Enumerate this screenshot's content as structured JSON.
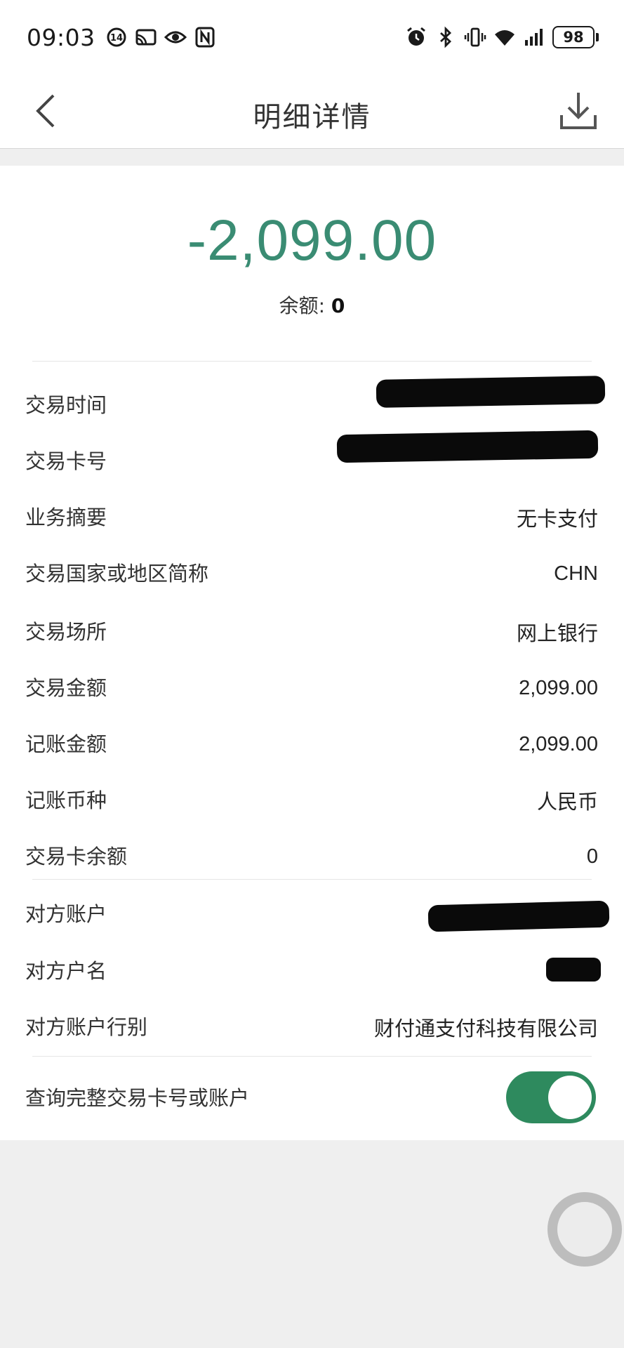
{
  "status_bar": {
    "time": "09:03",
    "battery": "98",
    "left_icons": [
      "sync-icon",
      "cast-icon",
      "eye-icon",
      "nfc-icon"
    ],
    "right_icons": [
      "alarm-icon",
      "bluetooth-icon",
      "vibrate-icon",
      "wifi-icon",
      "signal-icon",
      "battery-icon"
    ]
  },
  "nav": {
    "title": "明细详情",
    "back_icon": "chevron-left-icon",
    "download_icon": "download-icon"
  },
  "summary": {
    "amount": "-2,099.00",
    "balance_label": "余额:",
    "balance_value": "0",
    "amount_color": "#3a8c73"
  },
  "details": [
    {
      "label": "交易时间",
      "value": ""
    },
    {
      "label": "交易卡号",
      "value": ""
    },
    {
      "label": "业务摘要",
      "value": "无卡支付"
    },
    {
      "label": "交易国家或地区简称",
      "value": "CHN"
    },
    {
      "label": "交易场所",
      "value": "网上银行"
    },
    {
      "label": "交易金额",
      "value": "2,099.00"
    },
    {
      "label": "记账金额",
      "value": "2,099.00"
    },
    {
      "label": "记账币种",
      "value": "人民币"
    },
    {
      "label": "交易卡余额",
      "value": "0"
    }
  ],
  "counterparty": [
    {
      "label": "对方账户",
      "value": ""
    },
    {
      "label": "对方户名",
      "value": ""
    },
    {
      "label": "对方账户行别",
      "value": "财付通支付科技有限公司"
    }
  ],
  "toggle_row": {
    "label": "查询完整交易卡号或账户",
    "enabled": true,
    "color": "#2e8a5e"
  }
}
